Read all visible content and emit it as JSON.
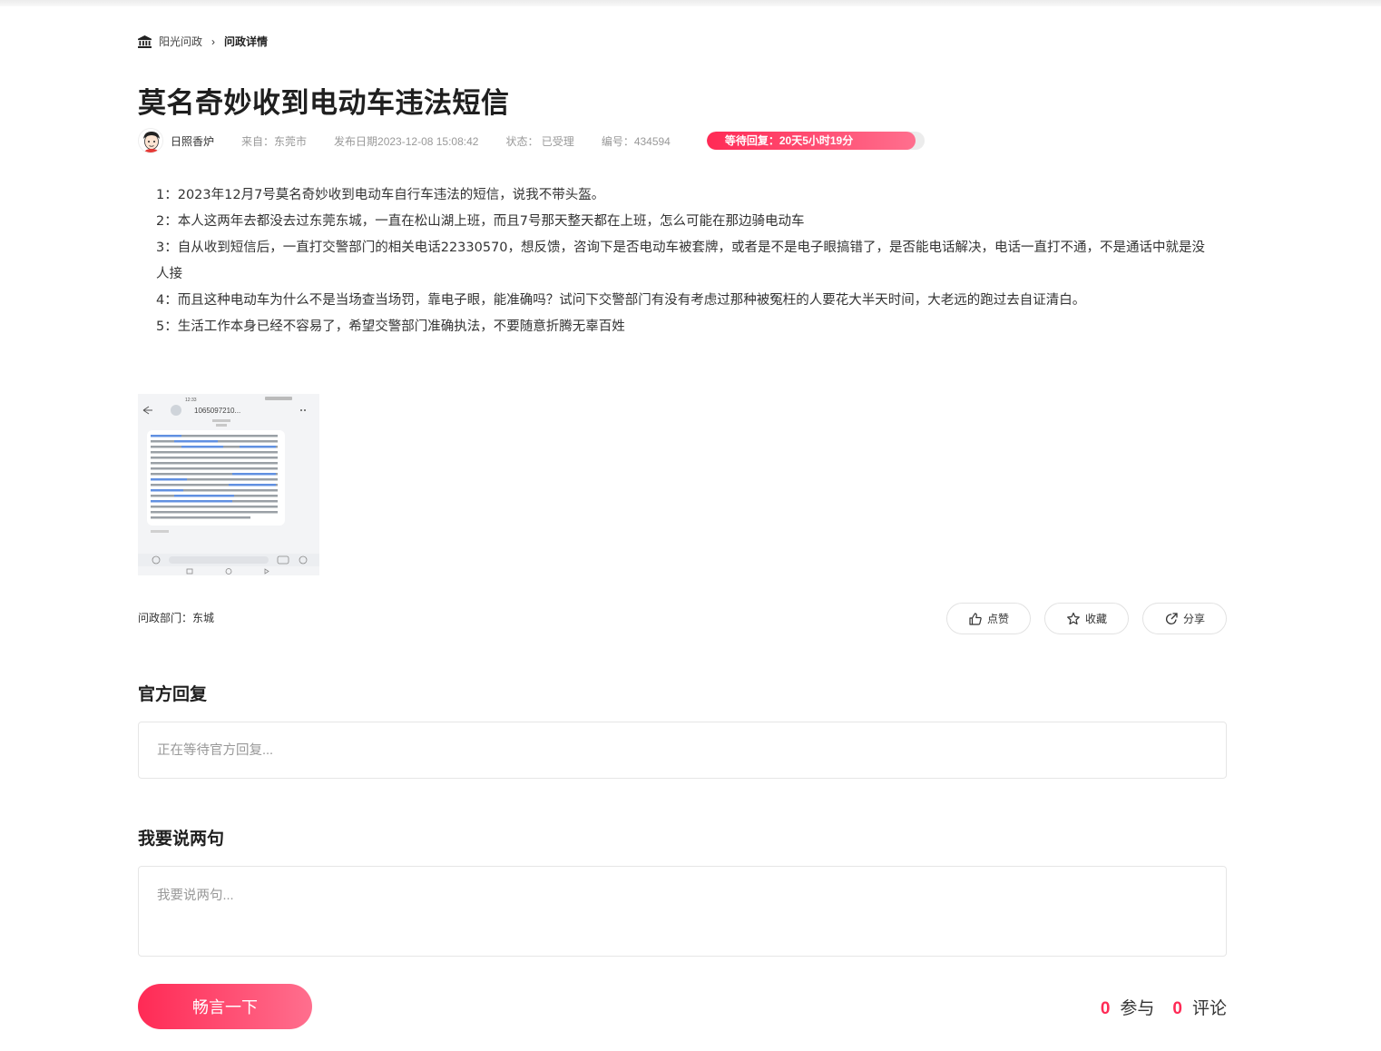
{
  "breadcrumb": {
    "home": "阳光问政",
    "current": "问政详情"
  },
  "title": "莫名奇妙收到电动车违法短信",
  "meta": {
    "author": "日照香炉",
    "source": "来自：东莞市",
    "date": "发布日期2023-12-08 15:08:42",
    "status": "状态：  已受理",
    "number": "编号：434594",
    "waiting": "等待回复：20天5小时19分",
    "waiting_progress": 0.96
  },
  "content": [
    "1：2023年12月7号莫名奇妙收到电动车自行车违法的短信，说我不带头盔。",
    "2：本人这两年去都没去过东莞东城，一直在松山湖上班，而且7号那天整天都在上班，怎么可能在那边骑电动车",
    "3：自从收到短信后，一直打交警部门的相关电话22330570，想反馈，咨询下是否电动车被套牌，或者是不是电子眼搞错了，是否能电话解决，电话一直打不通，不是通话中就是没人接",
    "4：而且这种电动车为什么不是当场查当场罚，靠电子眼，能准确吗？试问下交警部门有没有考虑过那种被冤枉的人要花大半天时间，大老远的跑过去自证清白。",
    "5：生活工作本身已经不容易了，希望交警部门准确执法，不要随意折腾无辜百姓"
  ],
  "attachment": {
    "time": "12:33",
    "sender": "1065097210..."
  },
  "department": "问政部门：东城",
  "actions": {
    "like": "点赞",
    "favorite": "收藏",
    "share": "分享"
  },
  "official_reply": {
    "title": "官方回复",
    "placeholder_text": "正在等待官方回复..."
  },
  "comment": {
    "title": "我要说两句",
    "placeholder": "我要说两句...",
    "submit_label": "畅言一下"
  },
  "stats": {
    "participants": "0",
    "participants_label": "参与",
    "comments": "0",
    "comments_label": "评论"
  },
  "colors": {
    "accent": "#ff2a55",
    "accent_light": "#ff6f8e"
  }
}
